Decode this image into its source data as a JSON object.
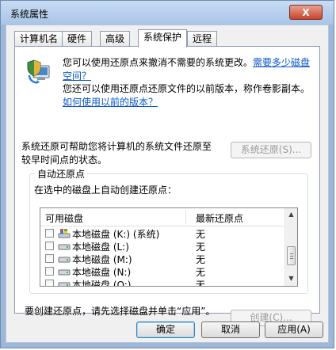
{
  "window": {
    "title": "系统属性",
    "close_label": "X"
  },
  "tabs": [
    {
      "label": "计算机名",
      "active": false
    },
    {
      "label": "硬件",
      "active": false
    },
    {
      "label": "高级",
      "active": false
    },
    {
      "label": "系统保护",
      "active": true
    },
    {
      "label": "远程",
      "active": false
    }
  ],
  "intro": {
    "text1": "您可以使用还原点来撤消不需要的系统更改。",
    "link1": "需要多少磁盘空间？",
    "text2": "您还可以使用还原点还原文件的以前版本，称作卷影副本。",
    "link2": "如何使用以前的版本？"
  },
  "restore": {
    "desc": "系统还原可帮助您将计算机的系统文件还原至较早时间点的状态。",
    "button": "系统还原(S)..."
  },
  "auto_restore": {
    "group_title": "自动还原点",
    "instruction": "在选中的磁盘上自动创建还原点：",
    "columns": [
      "可用磁盘",
      "最新还原点"
    ],
    "rows": [
      {
        "name": "本地磁盘 (K:) (系统)",
        "latest": "无",
        "system": true
      },
      {
        "name": "本地磁盘 (L:)",
        "latest": "无",
        "system": false
      },
      {
        "name": "本地磁盘 (M:)",
        "latest": "无",
        "system": false
      },
      {
        "name": "本地磁盘 (N:)",
        "latest": "无",
        "system": false
      },
      {
        "name": "本地磁盘 (O:)",
        "latest": "无",
        "system": false
      }
    ]
  },
  "create": {
    "desc": "要创建还原点，请先选择磁盘并单击“应用”。",
    "button": "创建(C)..."
  },
  "footer": {
    "ok": "确定",
    "cancel": "取消",
    "apply": "应用(A)"
  }
}
